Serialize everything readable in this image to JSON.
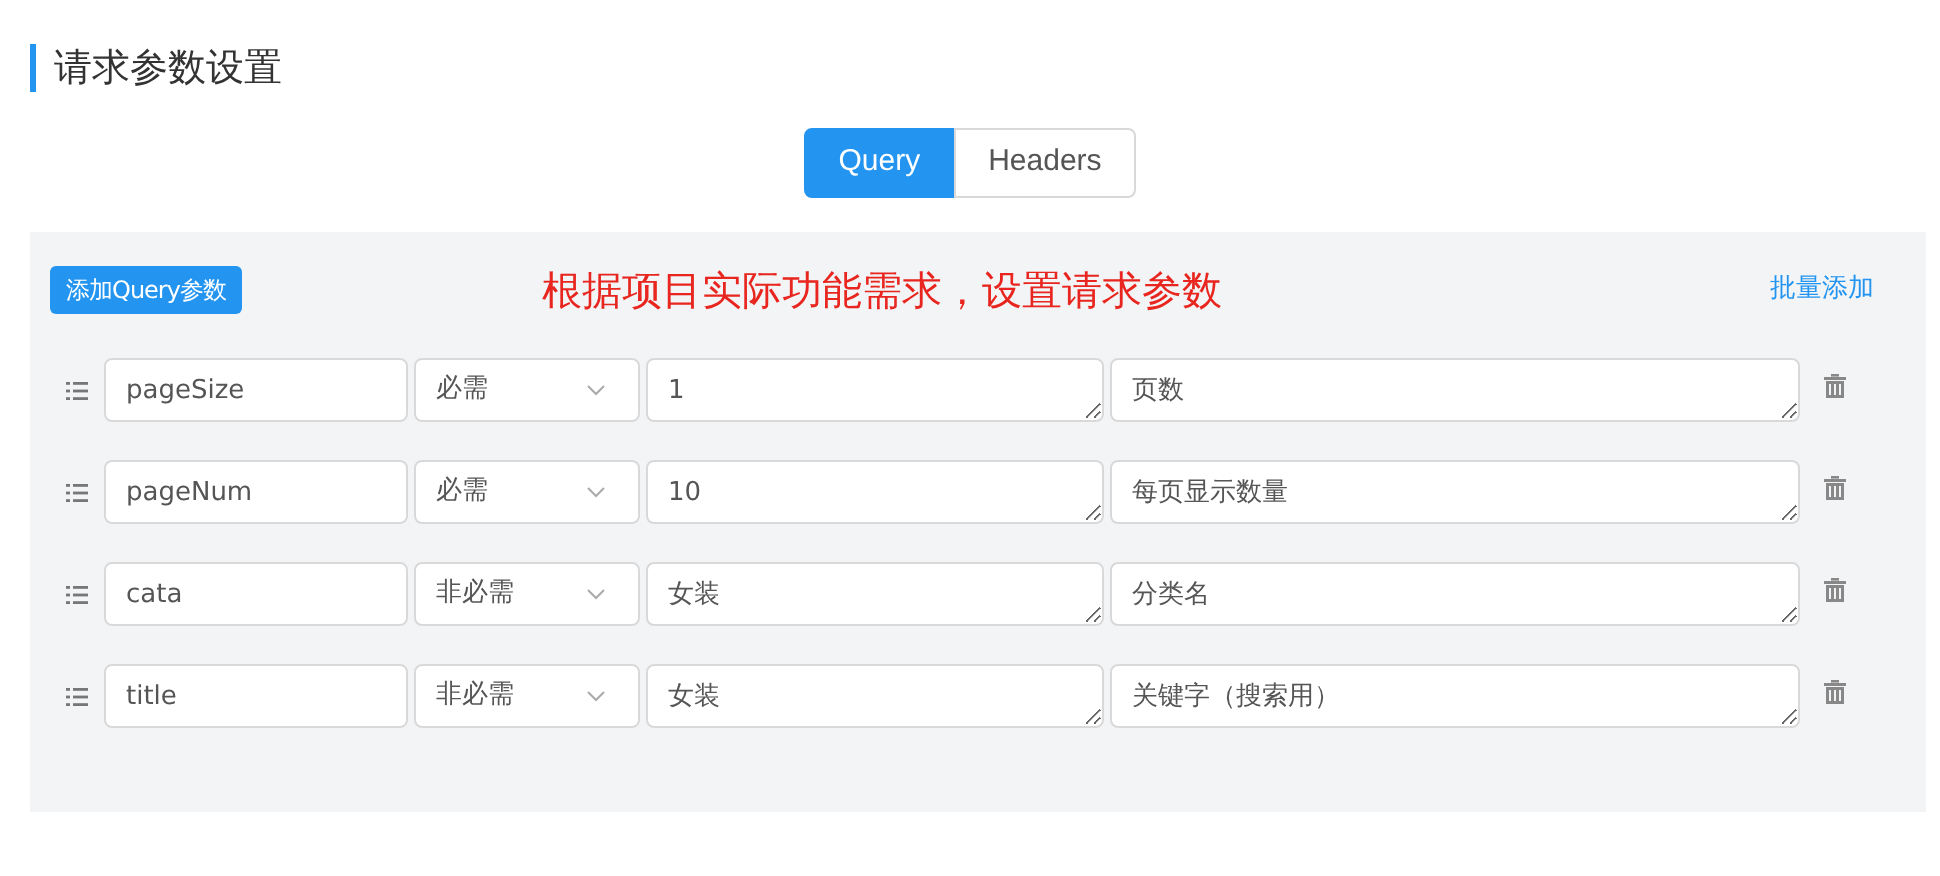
{
  "section_title": "请求参数设置",
  "tabs": [
    {
      "label": "Query",
      "selected": true
    },
    {
      "label": "Headers",
      "selected": false
    }
  ],
  "add_button": "添加Query参数",
  "annotation": "根据项目实际功能需求，设置请求参数",
  "bulk_add_link": "批量添加",
  "params": [
    {
      "name": "pageSize",
      "required": "必需",
      "value": "1",
      "description": "页数"
    },
    {
      "name": "pageNum",
      "required": "必需",
      "value": "10",
      "description": "每页显示数量"
    },
    {
      "name": "cata",
      "required": "非必需",
      "value": "女装",
      "description": "分类名"
    },
    {
      "name": "title",
      "required": "非必需",
      "value": "女装",
      "description": "关键字（搜索用）"
    }
  ]
}
